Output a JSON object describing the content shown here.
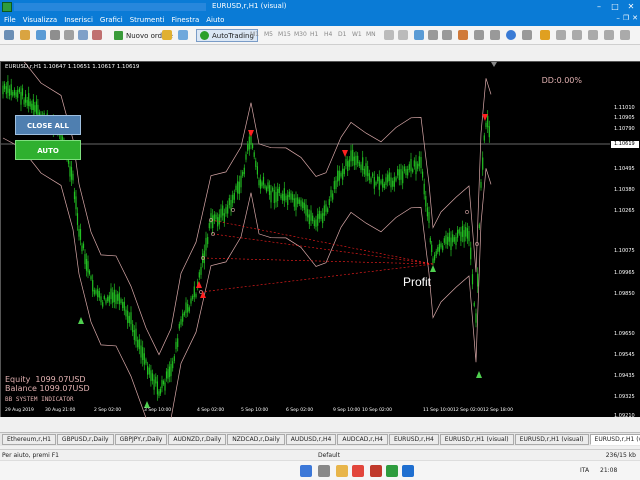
{
  "window": {
    "title": "EURUSD,r,H1 (visual)"
  },
  "menu": {
    "items": [
      "File",
      "Visualizza",
      "Inserisci",
      "Grafici",
      "Strumenti",
      "Finestra",
      "Aiuto"
    ]
  },
  "toolbar": {
    "new_order_label": "Nuovo ordine",
    "autotrading_label": "AutoTrading",
    "timeframes": [
      "M1",
      "M5",
      "M15",
      "M30",
      "H1",
      "H4",
      "D1",
      "W1",
      "MN"
    ]
  },
  "chart": {
    "header": "EURUSD,r,H1  1.10647 1.10651 1.10617 1.10619",
    "dd_label": "DD:0.00%",
    "close_all_label": "CLOSE ALL",
    "auto_label": "AUTO",
    "profit_label": "Profit",
    "equity_text": "Equity  1099.07USD",
    "balance_text": "Balance 1099.07USD",
    "indicator_name": "BB SYSTEM INDICATOR",
    "price_ticks": [
      "1.11010",
      "1.10905",
      "1.10790",
      "1.10619",
      "1.10495",
      "1.10380",
      "1.10265",
      "1.10075",
      "1.09965",
      "1.09850",
      "1.09650",
      "1.09545",
      "1.09435",
      "1.09325",
      "1.09210"
    ],
    "current_price": "1.10619",
    "time_ticks": [
      "29 Aug 2019",
      "30 Aug 21:00",
      "2 Sep 02:00",
      "3 Sep 10:00",
      "4 Sep 02:00",
      "5 Sep 10:00",
      "6 Sep 02:00",
      "9 Sep 10:00",
      "10 Sep 02:00",
      "11 Sep 10:00",
      "12 Sep 02:00",
      "12 Sep 18:00"
    ]
  },
  "tabs": [
    "Ethereum,r,H1",
    "GBPUSD,r,Daily",
    "GBPJPY,r,Daily",
    "AUDNZD,r,Daily",
    "NZDCAD,r,Daily",
    "AUDUSD,r,H4",
    "AUDCAD,r,H4",
    "EURUSD,r,H4",
    "EURUSD,r,H1 (visual)",
    "EURUSD,r,H1 (visual)",
    "EURUSD,r,H1 (visual)"
  ],
  "status": {
    "help": "Per aiuto, premi F1",
    "profile": "Default",
    "connection": "236/15 kb"
  },
  "taskbar": {
    "lang": "ITA",
    "time": "21:08"
  },
  "colors": {
    "candle": "#22c022",
    "band": "#d8a8a8",
    "signal": "#ff2020",
    "background": "#000000"
  }
}
